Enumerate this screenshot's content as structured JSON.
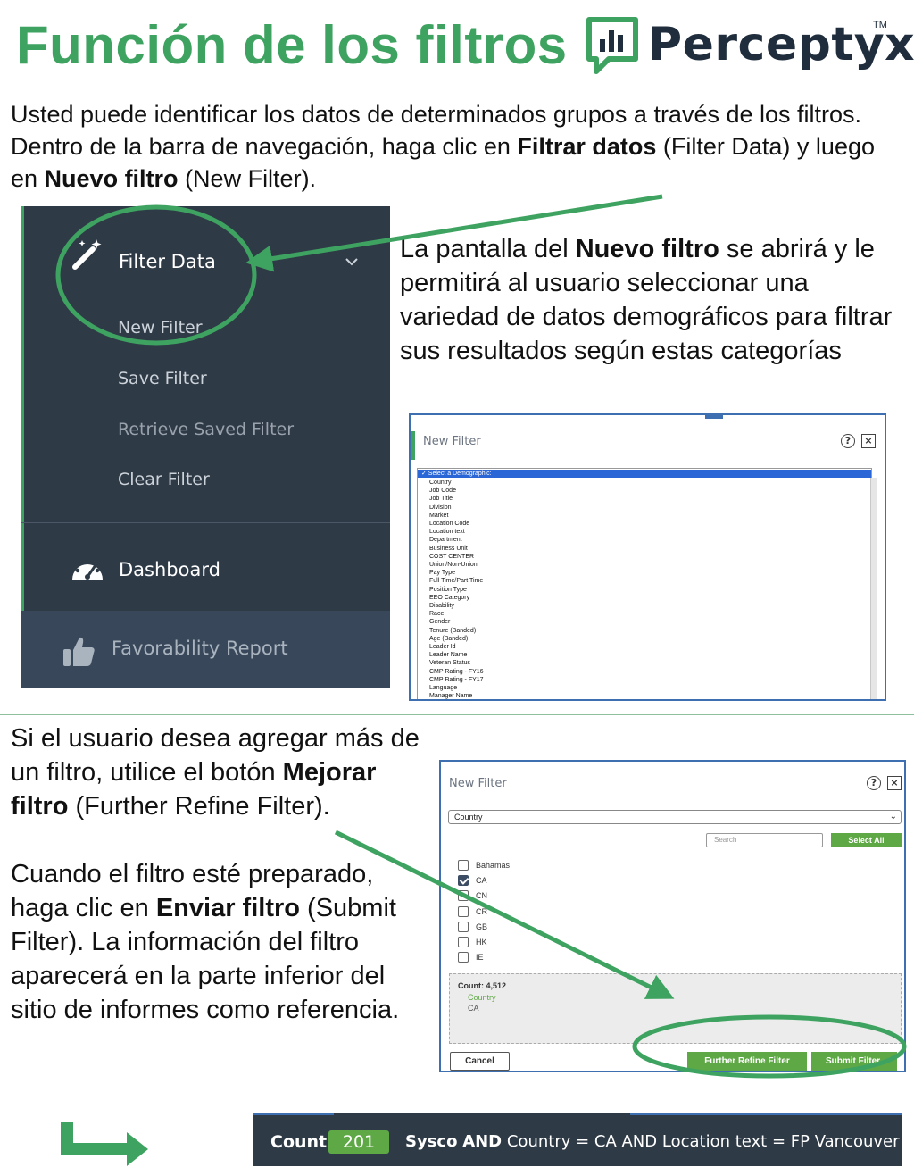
{
  "header": {
    "title": "Función de los filtros",
    "logo_text": "Perceptyx",
    "logo_tm": "TM"
  },
  "intro": {
    "part1": "Usted puede identificar los datos de determinados grupos a través de los filtros. Dentro de la barra de navegación, haga clic en ",
    "bold1": "Filtrar datos",
    "part2": " (Filter Data) y luego en ",
    "bold2": "Nuevo filtro",
    "part3": " (New Filter)."
  },
  "sidebar": {
    "filter_data": "Filter Data",
    "new_filter": "New Filter",
    "save_filter": "Save Filter",
    "retrieve_saved_filter": "Retrieve Saved Filter",
    "clear_filter": "Clear Filter",
    "dashboard": "Dashboard",
    "favorability_report": "Favorability Report"
  },
  "para_right": {
    "part1": "La pantalla del ",
    "bold1": "Nuevo filtro",
    "part2": " se abrirá y le permitirá al usuario seleccionar una variedad de datos demográficos para filtrar sus resultados según estas categorías"
  },
  "modal1": {
    "title": "New Filter",
    "help": "?",
    "close": "×",
    "selected_option": "✓ Select a Demographic:",
    "options": [
      "Country",
      "Job Code",
      "Job Title",
      "Division",
      "Market",
      "Location Code",
      "Location text",
      "Department",
      "Business Unit",
      "COST CENTER",
      "Union/Non-Union",
      "Pay Type",
      "Full Time/Part Time",
      "Position Type",
      "EEO Category",
      "Disability",
      "Race",
      "Gender",
      "Tenure (Banded)",
      "Age (Banded)",
      "Leader Id",
      "Leader Name",
      "Veteran Status",
      "CMP Rating - FY16",
      "CMP Rating - FY17",
      "Language",
      "Manager Name"
    ]
  },
  "bottom_left": {
    "p1_part1": "Si el usuario desea agregar más de un filtro, utilice el botón ",
    "p1_bold": "Mejorar filtro",
    "p1_part2": " (Further Refine Filter).",
    "p2_part1": "Cuando el filtro esté preparado, haga clic en ",
    "p2_bold": "Enviar filtro",
    "p2_part2": " (Submit Filter). La información del filtro aparecerá en la parte inferior del sitio de informes como referencia."
  },
  "modal2": {
    "title": "New Filter",
    "help": "?",
    "close": "×",
    "select_value": "Country",
    "search_placeholder": "Search",
    "select_all": "Select All",
    "items": [
      {
        "label": "Bahamas",
        "checked": false
      },
      {
        "label": "CA",
        "checked": true
      },
      {
        "label": "CN",
        "checked": false
      },
      {
        "label": "CR",
        "checked": false
      },
      {
        "label": "GB",
        "checked": false
      },
      {
        "label": "HK",
        "checked": false
      },
      {
        "label": "IE",
        "checked": false
      }
    ],
    "count_label": "Count: 4,512",
    "count_category": "Country",
    "count_value": "CA",
    "cancel": "Cancel",
    "further_refine": "Further Refine Filter",
    "submit": "Submit Filter"
  },
  "countbar": {
    "label": "Count:",
    "value": "201",
    "filter_sysco": "Sysco",
    "filter_and1": "AND",
    "filter_rest": "Country = CA AND Location text = FP Vancouver"
  },
  "colors": {
    "green": "#3ea360",
    "navy": "#2f3a47",
    "button_green": "#5fa846",
    "modal_border": "#3d6fb1"
  }
}
